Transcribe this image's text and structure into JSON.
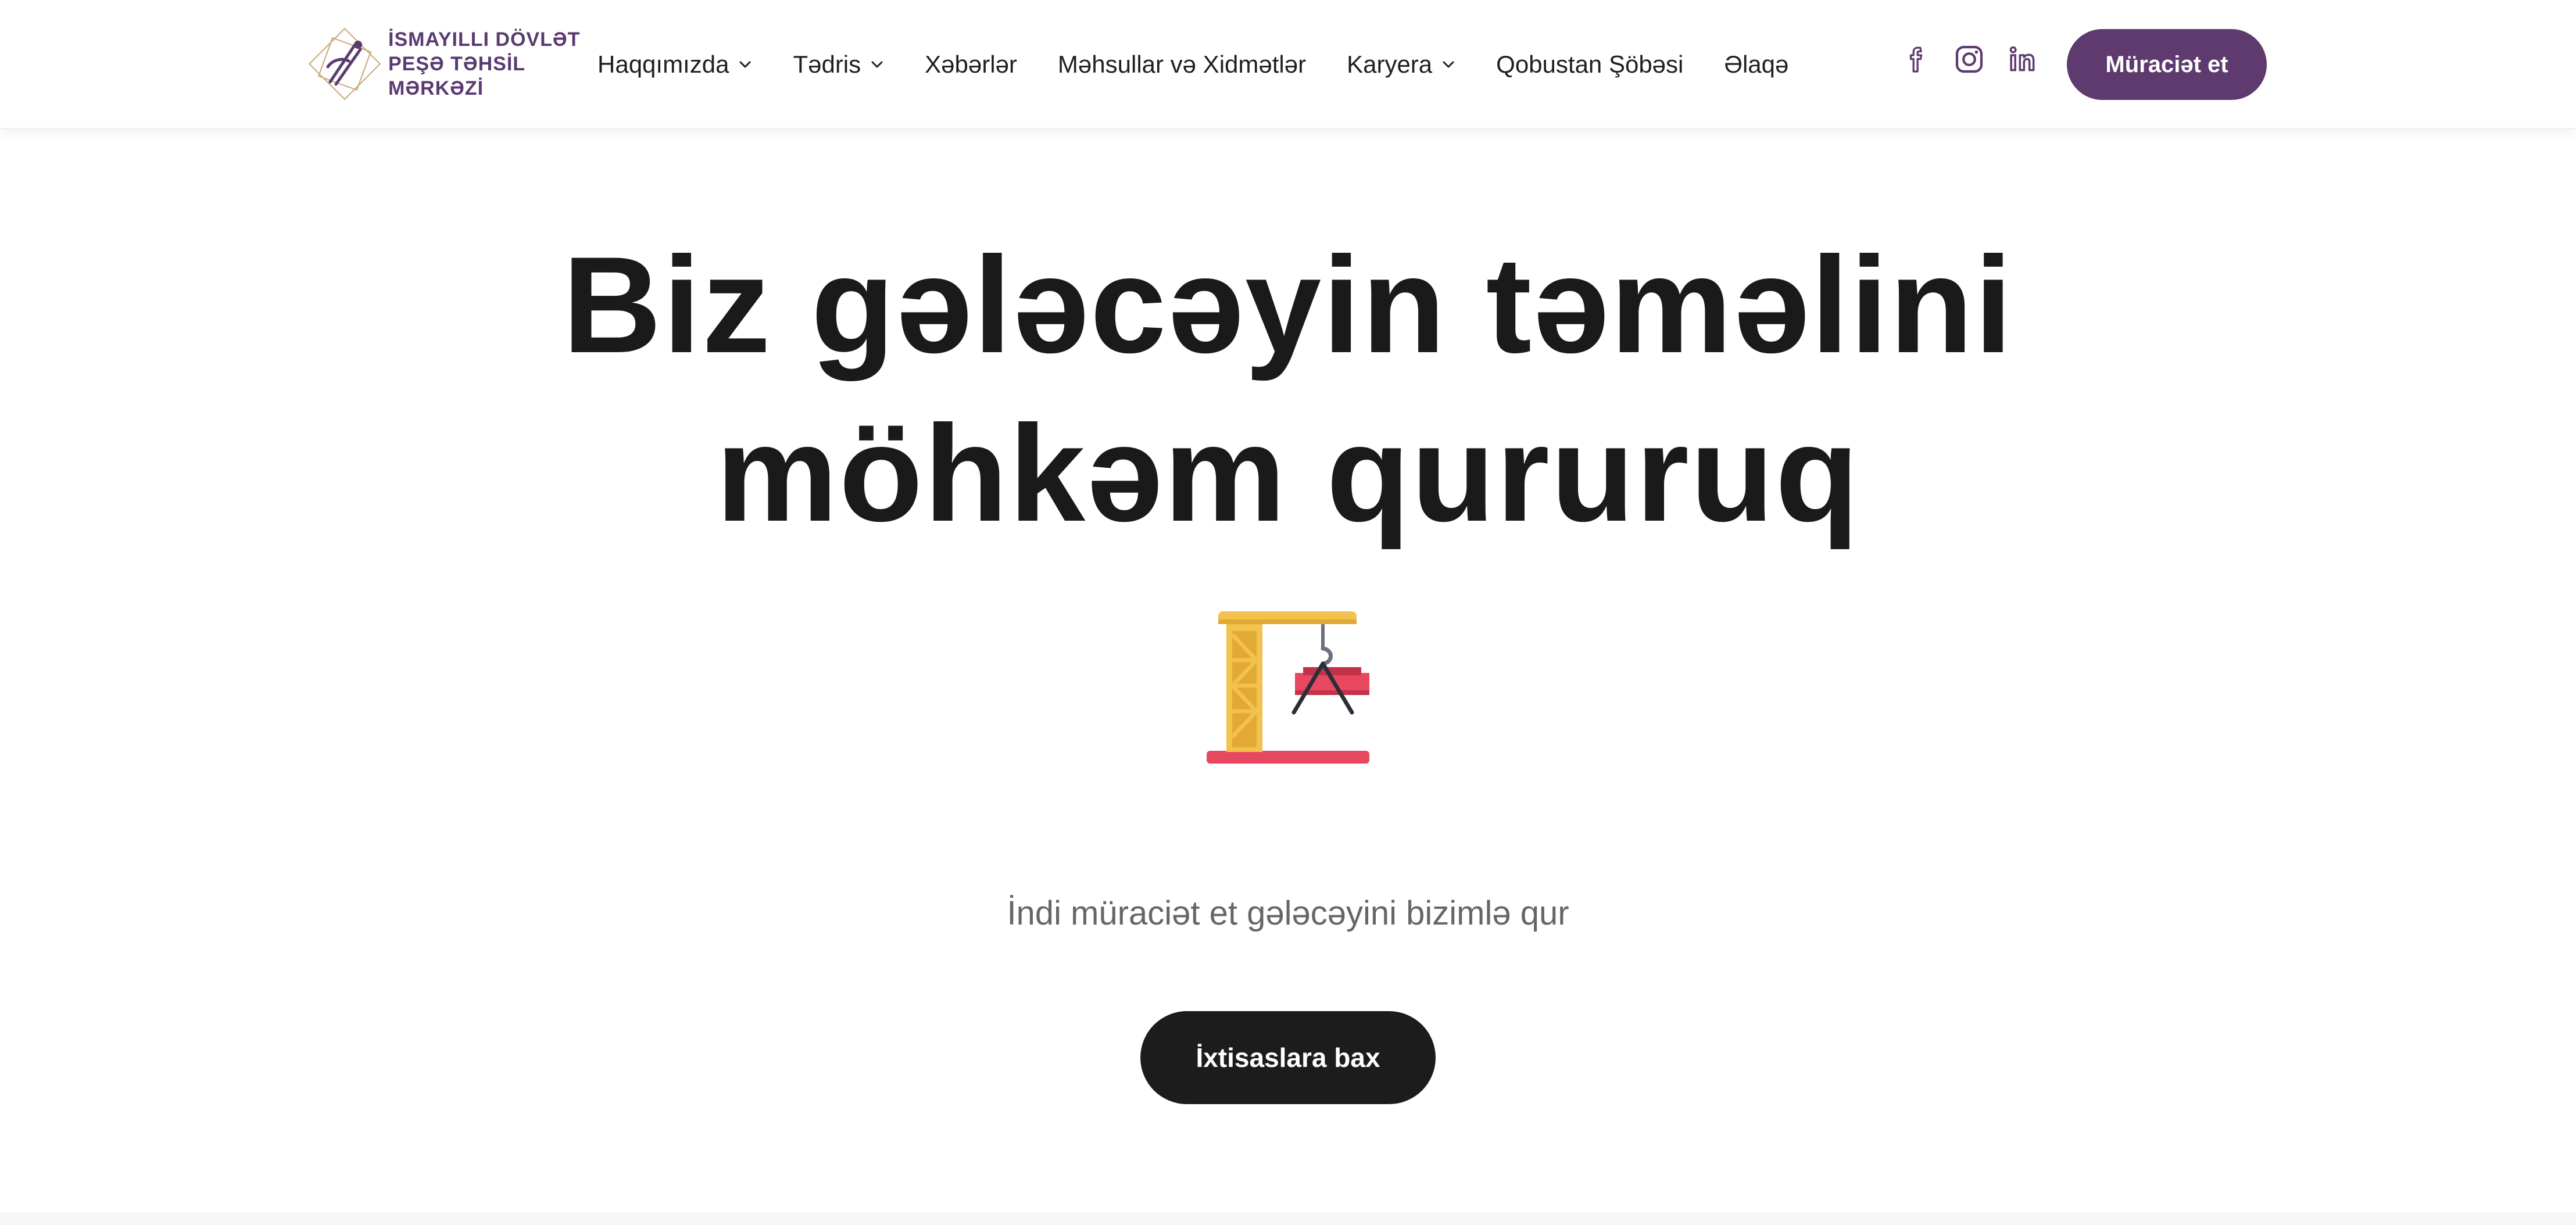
{
  "header": {
    "logo": {
      "line1": "İSMAYILLI DÖVLƏT",
      "line2": "PEŞƏ TƏHSİL",
      "line3": "MƏRKƏZİ"
    },
    "nav": [
      {
        "label": "Haqqımızda",
        "has_dropdown": true
      },
      {
        "label": "Tədris",
        "has_dropdown": true
      },
      {
        "label": "Xəbərlər",
        "has_dropdown": false
      },
      {
        "label": "Məhsullar və Xidmətlər",
        "has_dropdown": false
      },
      {
        "label": "Karyera",
        "has_dropdown": true
      },
      {
        "label": "Qobustan Şöbəsi",
        "has_dropdown": false
      },
      {
        "label": "Əlaqə",
        "has_dropdown": false
      }
    ],
    "social": [
      "facebook-icon",
      "instagram-icon",
      "linkedin-icon"
    ],
    "apply_label": "Müraciət et"
  },
  "hero": {
    "title_line1": "Biz gələcəyin təməlini",
    "title_line2": "möhkəm qururuq",
    "subtitle": "İndi müraciət et gələcəyini bizimlə qur",
    "cta_label": "İxtisaslara bax"
  },
  "colors": {
    "brand": "#5e3a6e",
    "cta": "#1c1c1c",
    "text": "#1a1a1a",
    "muted": "#666666"
  }
}
